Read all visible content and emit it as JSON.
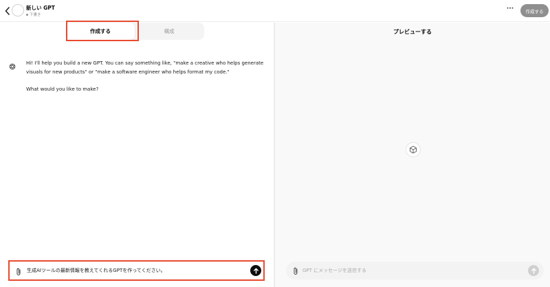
{
  "header": {
    "title": "新しい GPT",
    "status": "下書き",
    "more_label": "···",
    "create_button": "作成する"
  },
  "builder": {
    "tabs": [
      {
        "label": "作成する",
        "active": true
      },
      {
        "label": "構成",
        "active": false
      }
    ],
    "messages": [
      "Hi! I'll help you build a new GPT. You can say something like, \"make a creative who helps generate visuals for new products\" or \"make a software engineer who helps format my code.\"",
      "What would you like to make?"
    ],
    "input_value": "生成AIツールの最新情報を教えてくれるGPTを作ってください。"
  },
  "preview": {
    "title": "プレビューする",
    "input_placeholder": "GPT にメッセージを送信する"
  },
  "colors": {
    "highlight": "#e84a2f",
    "create_button_bg": "#8f8f8f",
    "send_active": "#0d0d0d",
    "send_disabled": "#d0d0d0"
  },
  "icons": {
    "back": "chevron-left-icon",
    "attach": "paperclip-icon",
    "send": "arrow-up-icon",
    "assistant": "openai-logo-icon",
    "preview": "cube-icon"
  }
}
